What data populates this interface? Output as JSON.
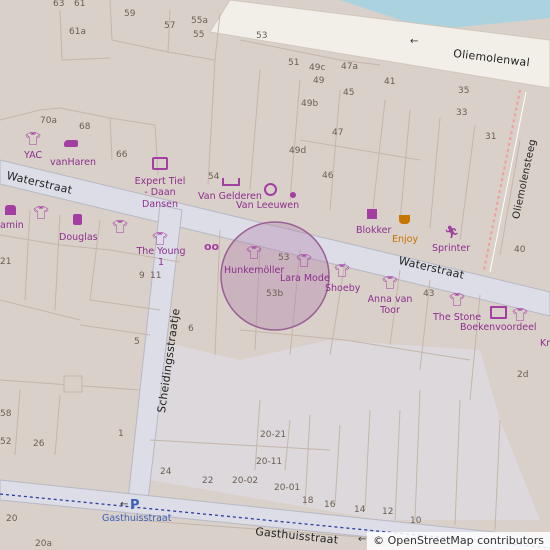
{
  "streets": {
    "waterstraat_left": "Waterstraat",
    "waterstraat_right": "Waterstraat",
    "oliemolenwal": "Oliemolenwal",
    "oliemolensteeg": "Oliemolensteeg",
    "scheidingsstraatje": "Scheidingsstraatje",
    "gasthuisstraat_label": "Gasthuisstraat",
    "gasthuisstraat_main": "Gasthuisstraat"
  },
  "pois": {
    "yac": "YAC",
    "vanharen": "vanHaren",
    "expert": "Expert Tiel - Daan Dansen",
    "van_gelderen": "Van Gelderen",
    "van_leeuwen": "Van Leeuwen",
    "blokker": "Blokker",
    "enjoy": "Enjoy",
    "sprinter": "Sprinter",
    "amin": "amin",
    "douglas": "Douglas",
    "the_young": "The Young 1",
    "hunkemoller": "Hunkemöller",
    "lara_mode": "Lara Mode",
    "shoeby": "Shoeby",
    "anna_van_toor": "Anna van Toor",
    "the_stone": "The Stone",
    "boekenvoordeel": "Boekenvoordeel",
    "kr": "Kr"
  },
  "house_numbers": [
    "63",
    "61",
    "59",
    "57",
    "55a",
    "55",
    "53",
    "61a",
    "51",
    "49c",
    "47a",
    "49",
    "45",
    "41",
    "35",
    "70a",
    "68",
    "49b",
    "33",
    "66",
    "47",
    "31",
    "49d",
    "54",
    "46",
    "40",
    "9",
    "11",
    "53",
    "53b",
    "43",
    "21",
    "6",
    "5",
    "2d",
    "58",
    "52",
    "26",
    "1",
    "20-21",
    "20-11",
    "24",
    "22",
    "20-02",
    "20-01",
    "18",
    "16",
    "14",
    "12",
    "10",
    "20a",
    "20"
  ],
  "attribution": {
    "prefix": "©",
    "text": "OpenStreetMap contributors"
  },
  "colors": {
    "building": "#d9d0c9",
    "building_outline": "#c4b6ab",
    "pedestrian": "#dddde8",
    "road_outline": "#b8b8c4",
    "water": "#aad3df",
    "poi": "#a33fa3",
    "highlight": "#b07aa8"
  },
  "icons": [
    "clothes-icon",
    "shoe-icon",
    "tv-icon",
    "bed-icon",
    "jewelry-icon",
    "dot-icon",
    "hardware-icon",
    "cafe-icon",
    "sports-icon",
    "gift-icon",
    "perfume-icon",
    "glasses-icon",
    "book-icon",
    "parking-icon",
    "arrow-icon"
  ]
}
